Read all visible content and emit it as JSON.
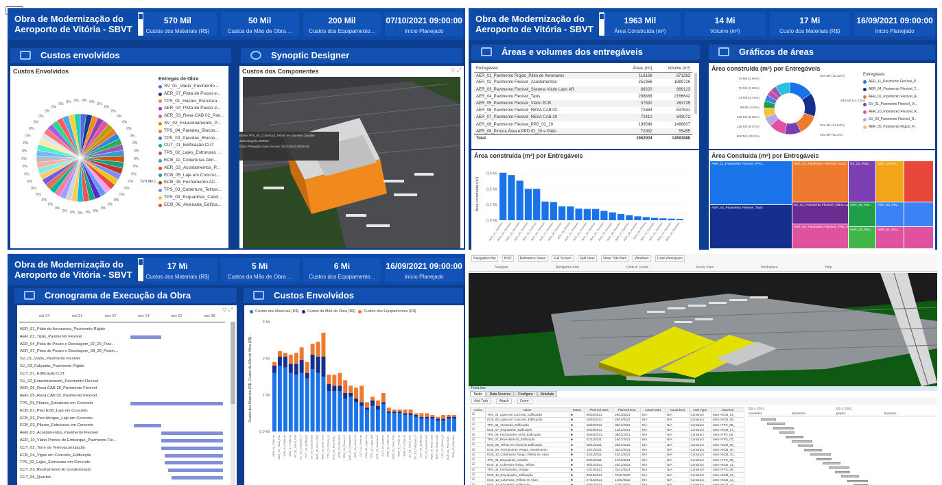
{
  "colors": {
    "header": "#0e4aa8",
    "section": "#1150b0",
    "bar": "#1a73e8",
    "orange": "#ee7a30",
    "navy": "#142f8e"
  },
  "q1": {
    "title": "Obra de Modernização do Aeroporto de Vitória - SBVT",
    "kpis": [
      {
        "value": "570 Mil",
        "label": "Custos dos Materiais (R$)"
      },
      {
        "value": "50 Mil",
        "label": "Custos da Mão de Obra ..."
      },
      {
        "value": "200 Mil",
        "label": "Custos dos Equipamento..."
      },
      {
        "value": "07/10/2021 09:00:00",
        "label": "Início Planejado"
      }
    ],
    "sec_left": "Custos envolvidos",
    "sec_right": "Synoptic Designer",
    "pie_title": "Custos Envolvidos",
    "legend_title": "Entregas de Obra",
    "legend": [
      {
        "label": "SV_01_Viário_Pavimento ...",
        "color": "#4e6de0"
      },
      {
        "label": "AER_07_Pista de Pouso e...",
        "color": "#1c3a8c"
      },
      {
        "label": "TPS_01_Hastes_Estrutura...",
        "color": "#f28c28"
      },
      {
        "label": "AER_04_Pista de Pouso e...",
        "color": "#8e44ad"
      },
      {
        "label": "AER_03_Resa CAB 02_Pav...",
        "color": "#e255a1"
      },
      {
        "label": "SV_02_Estacionamento_P...",
        "color": "#b3a100"
      },
      {
        "label": "TPS_04_Paredes_Blocos...",
        "color": "#e67e22"
      },
      {
        "label": "TPS_03_Paredes_Blocos...",
        "color": "#2e86de"
      },
      {
        "label": "CUT_01_Edificação CUT",
        "color": "#27ae60"
      },
      {
        "label": "TPS_02_Lajes_Estruturas ...",
        "color": "#9b59b6"
      },
      {
        "label": "ECB_11_Coberturas Abri...",
        "color": "#3498db"
      },
      {
        "label": "AER_03_Acostamentos_P...",
        "color": "#d35400"
      },
      {
        "label": "ECB_05_Laje em Concret...",
        "color": "#16a085"
      },
      {
        "label": "ECB_08_Fechamento AC...",
        "color": "#c0392b"
      },
      {
        "label": "TPS_03_Cobertura_Telhas...",
        "color": "#7f8cff"
      },
      {
        "label": "TPS_09_Esquadrias_Caixil...",
        "color": "#f1c40f"
      },
      {
        "label": "ECB_06_Alvenaria_Edifica...",
        "color": "#e74c3c"
      }
    ],
    "pie_callout": "570 Mil (3.41%)",
    "pie_zero": "0%",
    "synoptic_title": "Custos dos Componentes",
    "tooltip": [
      {
        "k": "Nome",
        "v": "TPS_05_Cobertura_Telhas em aluminio zipadas"
      },
      {
        "k": "Subcategoria",
        "v": "400000"
      },
      {
        "k": "Início Planejado mais recente",
        "v": "30/12/2023 09:00:00"
      }
    ]
  },
  "q2": {
    "title": "Obra de Modernização do Aeroporto de Vitória - SBVT",
    "kpis": [
      {
        "value": "1963 Mil",
        "label": "Área Construída (m²)"
      },
      {
        "value": "14 Mi",
        "label": "Volume (m³)"
      },
      {
        "value": "17 Mi",
        "label": "Custo dos Materiais (R$)"
      },
      {
        "value": "16/09/2021 09:00:00",
        "label": "Início Planejado"
      }
    ],
    "sec_left": "Áreas e volumes dos entregáveis",
    "sec_right": "Gráficos de áreas",
    "table_headers": [
      "Entregáveis",
      "Áreas (m²)",
      "Volume (m³)"
    ],
    "table_rows": [
      [
        "AER_01_Pavimento Rígido_Pátio de Aeronaves",
        "116168",
        "871263"
      ],
      [
        "AER_02_Pavimento Flexível_Acostamentos",
        "251966",
        "1889726"
      ],
      [
        "AER_03_Pavimento Flexível_Sistema Viário Lado AR",
        "89220",
        "669123"
      ],
      [
        "AER_04_Pavimento Flexível_Taxis",
        "288888",
        "2166642"
      ],
      [
        "AER_05_Pavimento Flexível_Viário ECB",
        "37832",
        "283735"
      ],
      [
        "AER_06_Pavimento Flexível_RESA CAB 02",
        "71684",
        "537631"
      ],
      [
        "AER_07_Pavimento Flexível_RESA CAB 20",
        "72410",
        "543072"
      ],
      [
        "AER_08_Pavimento Flexível_PPD_02_20",
        "199548",
        "1496607"
      ],
      [
        "AER_09_Pintura Área e PPD 02_20 e Pátio",
        "72932",
        "55455"
      ]
    ],
    "table_total": [
      "Total",
      "1962004",
      "14693888"
    ],
    "bar_title": "Área construída (m²) por Entregáveis",
    "bar_ylabel": "Área construída (m²)",
    "donut_title": "Área construída (m²) por Entregáveis",
    "donut_legend_title": "Entregáveis",
    "donut_legend": [
      {
        "label": "AER_11_Pavimento Flexível_P...",
        "color": "#1a73e8"
      },
      {
        "label": "AER_04_Pavimento Flexível_T...",
        "color": "#142f8e"
      },
      {
        "label": "AER_02_Pavimento Flexível_A...",
        "color": "#ee7a30"
      },
      {
        "label": "SV_01_Pavimento Flexível_Vi...",
        "color": "#7b3fb3"
      },
      {
        "label": "AER_10_Pavimento Flexível_R...",
        "color": "#e052a0"
      },
      {
        "label": "SV_03_Pavimento Flexível_R...",
        "color": "#b3a7e8"
      },
      {
        "label": "AER_05_Pavimento Rígido_P...",
        "color": "#f2c23a"
      }
    ],
    "donut_labels_left": [
      "72 Mil (3.66%)",
      "72 Mil (3.69%)",
      "74 Mil (3.79%)",
      "88 Mil (4.5%)",
      "116 Mil (5.92%)",
      "119 Mil (6.07%)",
      "200 Mil (10.2%)"
    ],
    "donut_labels_right": [
      "303 Mil (15.32%)",
      "288 Mil (14.72%)",
      "252 Mil (12.84%)",
      "200 Mil (10.2%)"
    ],
    "tree_title": "Área Constuída (m²) por Entregáveis",
    "tree_cells": [
      {
        "label": "AER_11_Pavimento Flexível_PPD...",
        "color": "#1a73e8"
      },
      {
        "label": "AER_02_Pavimento Flexível_Acost...",
        "color": "#ee7a30"
      },
      {
        "label": "SV_01_Pavi...",
        "color": "#7b3fb3"
      },
      {
        "label": "AER_10_Pa...",
        "color": "#f2a51a"
      },
      {
        "label": "AER_04_Pavimento Flexível_Taxis",
        "color": "#142f8e"
      },
      {
        "label": "SV_01_Pavimento Flexível_Viário La...",
        "color": "#6a2c91"
      },
      {
        "label": "AER_06_Pav...",
        "color": "#1f9e4a"
      },
      {
        "label": "AER_03_Pav...",
        "color": "#3b82f6"
      },
      {
        "label": "AER_09_Pavimento Flexível_PPD_02_20",
        "color": "#e052a0"
      },
      {
        "label": "AER_07_Pav...",
        "color": "#43b649"
      },
      {
        "label": "AER_01_Pav...",
        "color": "#e052a0"
      }
    ]
  },
  "q3": {
    "title": "Obra de Modernização do Aeroporto de Vitória - SBVT",
    "kpis": [
      {
        "value": "17 Mi",
        "label": "Custos dos Materiais (R$)"
      },
      {
        "value": "5 Mi",
        "label": "Custos da Mão de Obra ..."
      },
      {
        "value": "6 Mi",
        "label": "Custos dos Equipamento..."
      },
      {
        "value": "16/09/2021 09:00:00",
        "label": "Início Planejado"
      }
    ],
    "sec_left": "Cronograma de Execução da Obra",
    "sec_right": "Custos Envolvidos",
    "gantt_dates": [
      "out 24",
      "out 31",
      "nov 07",
      "nov 14",
      "nov 21",
      "nov 28"
    ],
    "gantt_rows": [
      "AER_01_Pátio de Aeronaves_Pavimento Rígido",
      "AER_02_Taxis_Pavimento Flexível",
      "AER_04_Pista de Pouso e Decolagem_02_20_Pavi...",
      "AER_07_Pista de Pouso e Decolagem_08_26_Pavim...",
      "SV_01_Viário_Pavimento Flexível",
      "SV_03_Calçadas_Pavimento Rígido",
      "CUT_01_Edificação CUT",
      "SV_02_Estacionamento_Pavimento Flexível",
      "AER_06_Resa CAB 20_Pavimento Flexível",
      "AER_05_Resa CAB 02_Pavimento Flexível",
      "TPS_01_Pilares_Estruturas em Concreto",
      "ECB_01_Piso ECB_Laje em Concreto",
      "ECB_02_Piso Abrigos_Laje em Concreto",
      "ECB_03_Pilares_Estruturas em Concreto",
      "AER_03_Acostamentos_Pavimento Flexível",
      "AER_10_Viário Pontes de Embarque_Pavimento Fle...",
      "CUT_02_Torre de Termoacumulação",
      "ECB_04_Vigas em Concreto_Edificação",
      "TPS_02_Lajes_Estruturas em Concreto",
      "CUT_03_Resfriamento Ar Condicionado",
      "CUT_06_Quartos"
    ],
    "legend": [
      {
        "label": "Custos dos Materiais (R$)",
        "color": "#1a73e8"
      },
      {
        "label": "Custos da Mão de Obra (R$)",
        "color": "#142f8e"
      },
      {
        "label": "Custos dos Equipamentos (R$)",
        "color": "#ee7a30"
      }
    ],
    "ylabel": "Custos dos Materiais (R$), Custos da Mão de Obra (R$)..."
  },
  "q4": {
    "ribbon_groups": [
      "Navigate",
      "Navigation Aids",
      "Grids & Levels",
      "Scene View",
      "Workspace",
      "Help"
    ],
    "ribbon_buttons": [
      "Navigation Bar",
      "HUD",
      "Reference Views",
      "Full Screen",
      "Split View",
      "Show Title Bars",
      "Windows",
      "Load Workspace"
    ],
    "panel_title": "TimeLiner",
    "tabs": [
      "Tasks",
      "Data Sources",
      "Configure",
      "Simulate"
    ],
    "toolbar": [
      "Add Task",
      "Attach",
      "Zoom:"
    ],
    "columns": [
      "Active",
      "Name",
      "Status",
      "Planned Start",
      "Planned End",
      "Actual Start",
      "Actual End",
      "Task Type",
      "Attached"
    ],
    "timeline_headers": [
      "Qtr 4, 2021",
      "Qtr 1, 2022",
      "novembro",
      "dezembro",
      "janeiro",
      "fevereiro"
    ],
    "rows": [
      [
        "TPS_04_Lajes em Concreto_Edificação",
        "05/10/2021",
        "29/10/2021",
        "N/A",
        "N/A",
        "Construct",
        "Sets->ECB_04_"
      ],
      [
        "ECB_05_Lajes em Concreto_Edificação",
        "15/10/2021",
        "29/10/2021",
        "N/A",
        "N/A",
        "Construct",
        "Sets->ECB_05_"
      ],
      [
        "TPS_05_Alvenaria_Edificação",
        "18/10/2021",
        "05/11/2021",
        "N/A",
        "N/A",
        "Construct",
        "Sets->TPS_05_"
      ],
      [
        "ECB_07_Esquadrias_Edificação",
        "25/10/2021",
        "12/11/2021",
        "N/A",
        "N/A",
        "Construct",
        "Sets->ECB_07_"
      ],
      [
        "TPS_06_Fechamento ACM_Edificação",
        "26/10/2021",
        "09/11/2021",
        "N/A",
        "N/A",
        "Construct",
        "Sets->TPS_06_"
      ],
      [
        "TPS_07_Revestimento_Edificação",
        "01/11/2021",
        "19/11/2021",
        "N/A",
        "N/A",
        "Construct",
        "Sets->TPS_07_"
      ],
      [
        "ECB_08_Telhas em Aluminio Edificação",
        "08/11/2021",
        "26/11/2021",
        "N/A",
        "N/A",
        "Construct",
        "Sets->ECB_08_"
      ],
      [
        "ECB_09_Fechamento Vergas_Investimento",
        "15/11/2021",
        "03/12/2021",
        "N/A",
        "N/A",
        "Construct",
        "Sets->ECB_09_"
      ],
      [
        "ECB_10_Coberturas Abrigo_Telhas em Alum",
        "22/11/2021",
        "10/12/2021",
        "N/A",
        "N/A",
        "Construct",
        "Sets->ECB_10_"
      ],
      [
        "TPS_08_Esquadrias_Caixilho",
        "29/11/2021",
        "17/12/2021",
        "N/A",
        "N/A",
        "Construct",
        "Sets->TPS_08_"
      ],
      [
        "ECB_11_Cobertura Abrigo_Telhas",
        "06/12/2021",
        "24/12/2021",
        "N/A",
        "N/A",
        "Construct",
        "Sets->ECB_11_"
      ],
      [
        "TPS_09_Fechamento_Vergas",
        "13/12/2021",
        "31/12/2021",
        "N/A",
        "N/A",
        "Construct",
        "Sets->TPS_09_"
      ],
      [
        "ECB_12_Esq Quadro_Edificação",
        "20/12/2021",
        "07/01/2022",
        "N/A",
        "N/A",
        "Construct",
        "Sets->ECB_12_"
      ],
      [
        "ECB_13_Cobertura_Telhas em Alum",
        "27/12/2021",
        "14/01/2022",
        "N/A",
        "N/A",
        "Construct",
        "Sets->ECB_13_"
      ],
      [
        "ECB_14_Esquadria_Edificação",
        "03/01/2022",
        "21/01/2022",
        "N/A",
        "N/A",
        "Construct",
        "Sets->ECB_14_"
      ],
      [
        "TPS_10_Esquadria_Vidro",
        "10/01/2022",
        "28/01/2022",
        "N/A",
        "N/A",
        "Construct",
        "Sets->TPS_10_"
      ]
    ]
  },
  "chart_data": [
    {
      "type": "bar",
      "title": "Área construída (m²) por Entregáveis",
      "ylabel": "Área construída (m²)",
      "ylim": [
        0,
        0.35
      ],
      "yticks": [
        "0,3 Mi",
        "0,2 Mi",
        "0,1 Mi",
        "0,0 Mi"
      ],
      "values": [
        0.303,
        0.288,
        0.252,
        0.2,
        0.2,
        0.119,
        0.116,
        0.089,
        0.088,
        0.074,
        0.072,
        0.072,
        0.06,
        0.05,
        0.04,
        0.032,
        0.025,
        0.02,
        0.015,
        0.012,
        0.01,
        0.008
      ]
    },
    {
      "type": "bar",
      "title": "Custos Envolvidos",
      "stacked": true,
      "ylim": [
        0,
        3
      ],
      "yticks": [
        "3 Mi",
        "2 Mi",
        "1 Mi",
        "0,0 Mi"
      ],
      "series": [
        {
          "name": "Custos dos Materiais (R$)",
          "values": [
            1.6,
            1.8,
            1.75,
            1.6,
            1.55,
            1.6,
            1.45,
            1.7,
            1.6,
            1.5,
            1.1,
            1.1,
            1.1,
            0.9,
            0.95,
            0.8,
            0.7,
            0.6,
            0.7,
            0.6,
            0.75,
            0.5,
            0.5,
            0.5,
            0.45,
            0.45,
            0.4,
            0.35,
            0.35,
            0.35,
            0.3,
            0.3,
            0.35,
            0.35
          ]
        },
        {
          "name": "Custos da Mão de Obra (R$)",
          "values": [
            0.2,
            0.25,
            0.3,
            0.25,
            0.3,
            0.35,
            0.15,
            0.4,
            0.45,
            0.55,
            0.2,
            0.15,
            0.15,
            0.15,
            0.1,
            0.1,
            0.1,
            0.05,
            0.15,
            0.1,
            0.05,
            0.05,
            0.05,
            0.05,
            0.05,
            0.05,
            0.05,
            0.05,
            0.05,
            0.05,
            0.05,
            0.05,
            0.05,
            0.05
          ]
        },
        {
          "name": "Custos dos Equipamentos (R$)",
          "values": [
            0.1,
            0.15,
            0.1,
            0.25,
            0.3,
            0.35,
            0.3,
            0.3,
            0.4,
            0.65,
            0.25,
            0.3,
            0.35,
            0.35,
            0.2,
            0.3,
            0.45,
            0.15,
            0.1,
            0.15,
            0.25,
            0.1,
            0.05,
            0.05,
            0.1,
            0.1,
            0.05,
            0.1,
            0.1,
            0.05,
            0.05,
            0.1,
            0.05,
            0.05
          ]
        }
      ]
    },
    {
      "type": "pie",
      "title": "Área construída (m²) por Entregáveis",
      "values": [
        15.32,
        14.72,
        12.84,
        10.2,
        10.2,
        6.07,
        5.92,
        4.5,
        3.79,
        3.69,
        3.66,
        9.09
      ]
    }
  ]
}
